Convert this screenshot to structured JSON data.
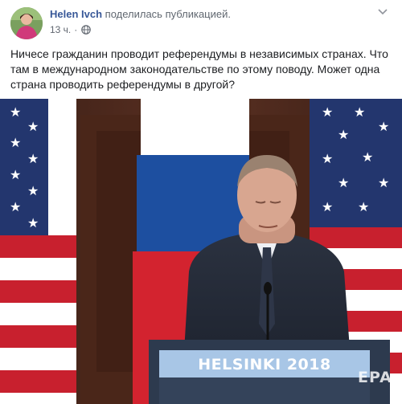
{
  "post": {
    "author_name": "Helen Ivch",
    "author_action": "поделилась публикацией.",
    "timestamp": "13 ч.",
    "separator": "·",
    "privacy_icon": "globe-icon",
    "more_icon": "chevron-down-icon",
    "text": "Ничесе гражданин проводит референдумы в независимых странах. Что там в международном законодательстве по этому поводу. Может одна страна проводить референдумы в другой?"
  },
  "photo": {
    "podium_text": "HELSINKI 2018",
    "watermark": "EPA"
  },
  "colors": {
    "link": "#385898",
    "meta": "#616770",
    "text": "#1c1e21",
    "podium": "#a8c6e6"
  }
}
